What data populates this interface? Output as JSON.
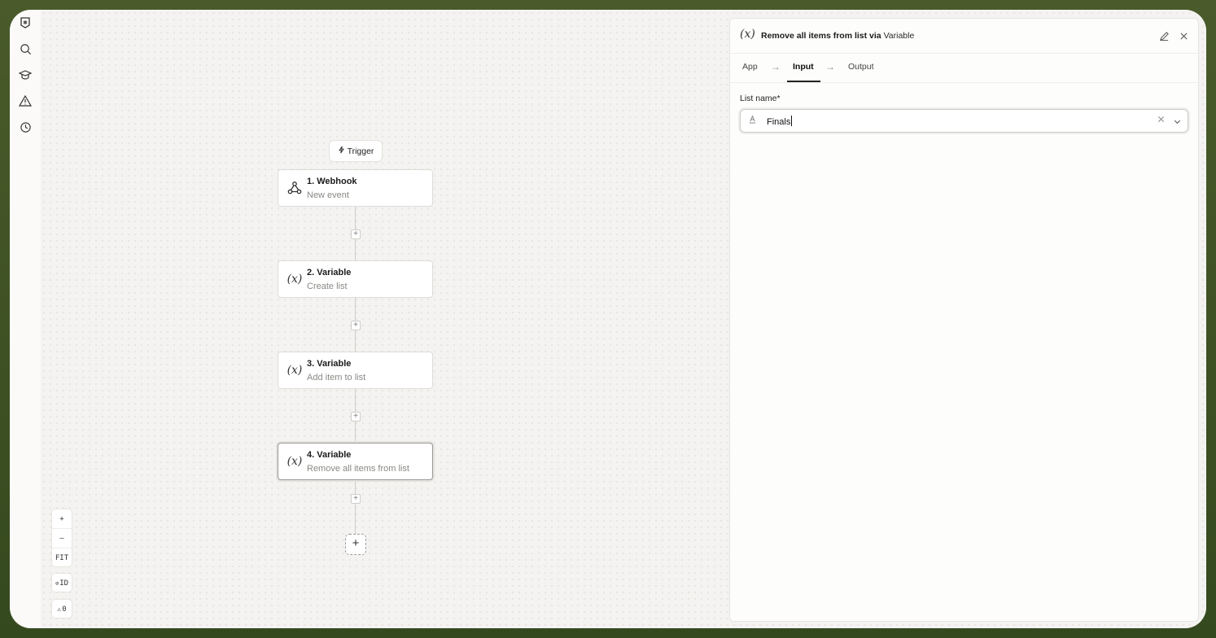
{
  "sidebar": {
    "items": [
      {
        "icon": "star-badge-icon"
      },
      {
        "icon": "search-icon"
      },
      {
        "icon": "graduation-cap-icon"
      },
      {
        "icon": "warning-icon"
      },
      {
        "icon": "history-icon"
      }
    ]
  },
  "canvas": {
    "trigger_label": "Trigger",
    "nodes": [
      {
        "title": "1. Webhook",
        "subtitle": "New event",
        "icon": "webhook-icon"
      },
      {
        "title": "2. Variable",
        "subtitle": "Create list",
        "icon": "variable-icon"
      },
      {
        "title": "3. Variable",
        "subtitle": "Add item to list",
        "icon": "variable-icon"
      },
      {
        "title": "4. Variable",
        "subtitle": "Remove all items from list",
        "icon": "variable-icon"
      }
    ],
    "variable_glyph": "(x)",
    "selected_node": 4
  },
  "controls": {
    "zoom_in": "+",
    "zoom_out": "—",
    "fit": "FIT",
    "id_toggle": "ID",
    "warnings_count": "0"
  },
  "panel": {
    "icon_glyph": "(x)",
    "title_prefix": "Remove all items from list via ",
    "title_app": "Variable",
    "tabs": [
      {
        "label": "App"
      },
      {
        "label": "Input",
        "active": true
      },
      {
        "label": "Output"
      }
    ],
    "field": {
      "label": "List name*",
      "value": "Finals"
    }
  }
}
